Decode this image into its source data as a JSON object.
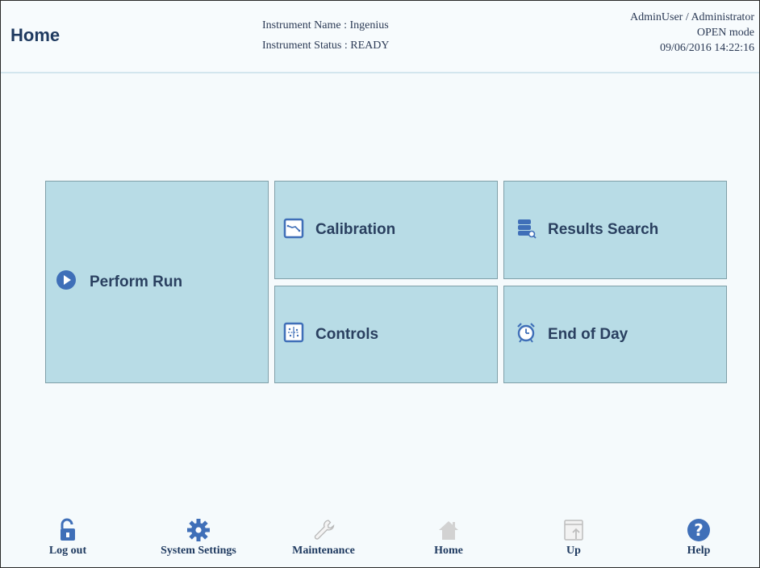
{
  "header": {
    "title": "Home",
    "instrument_name": "Instrument Name :  Ingenius",
    "instrument_status": "Instrument Status : READY",
    "user": "AdminUser / Administrator",
    "mode": "OPEN mode",
    "datetime": "09/06/2016 14:22:16"
  },
  "tiles": {
    "perform_run": "Perform Run",
    "calibration": "Calibration",
    "results_search": "Results Search",
    "controls": "Controls",
    "end_of_day": "End of Day"
  },
  "footer": {
    "logout": "Log out",
    "system_settings": "System Settings",
    "maintenance": "Maintenance",
    "home": "Home",
    "up": "Up",
    "help": "Help"
  },
  "colors": {
    "tile_bg": "#b8dce6",
    "accent": "#3f6fb8",
    "text_dark": "#1f3a60"
  }
}
